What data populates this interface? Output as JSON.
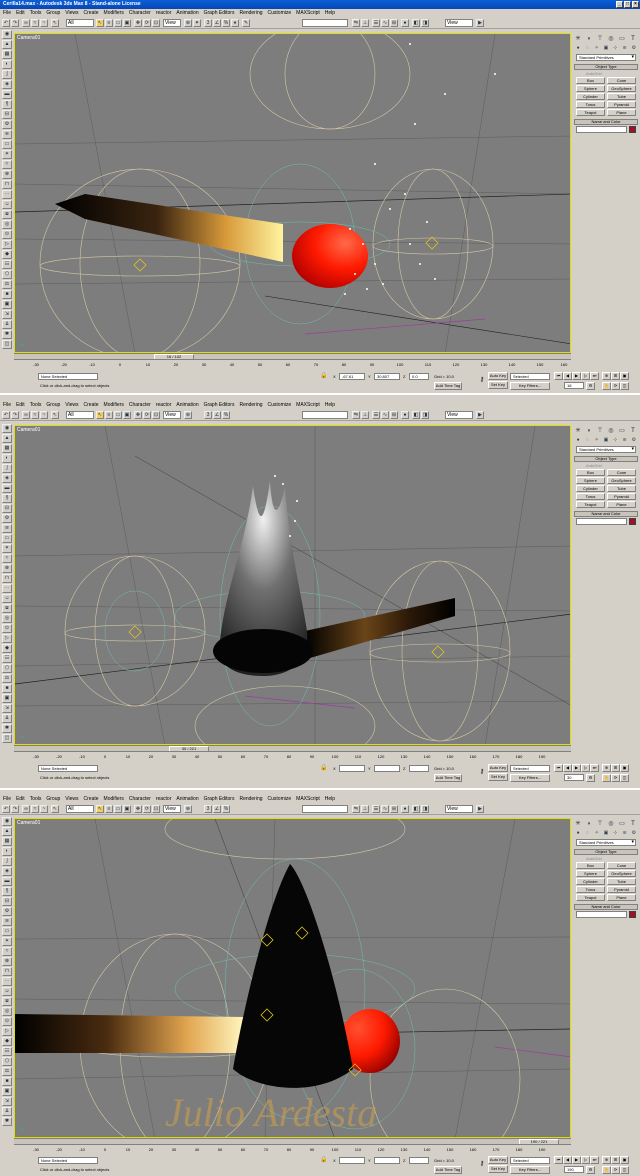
{
  "app": {
    "title": "Cerilla14.max - Autodesk 3ds Max 8 - Stand-alone License",
    "win_buttons": [
      "_",
      "□",
      "×"
    ]
  },
  "menu": [
    "File",
    "Edit",
    "Tools",
    "Group",
    "Views",
    "Create",
    "Modifiers",
    "Character",
    "reactor",
    "Animation",
    "Graph Editors",
    "Rendering",
    "Customize",
    "MAXScript",
    "Help"
  ],
  "toolbar": {
    "selection_filter": "All",
    "ref_coord": "View",
    "named_selection": "",
    "view_dropdown": "View"
  },
  "viewport": {
    "label": "Camera01"
  },
  "command_panel": {
    "category": "Standard Primitives",
    "object_type_header": "Object Type",
    "autogrid": "AutoGrid",
    "primitives": [
      "Box",
      "Cone",
      "Sphere",
      "GeoSphere",
      "Cylinder",
      "Tube",
      "Torus",
      "Pyramid",
      "Teapot",
      "Plane"
    ],
    "name_color_header": "Name and Color",
    "swatch_color": "#a0102a"
  },
  "colors": {
    "viewport_bg": "#7d7d7d",
    "active_border": "#e0e000",
    "match_red": "#ff2a00",
    "wood": "#d4a24a"
  },
  "ruler_ticks": [
    "-30",
    "-20",
    "-10",
    "0",
    "10",
    "20",
    "30",
    "40",
    "50",
    "60",
    "70",
    "80",
    "90",
    "100",
    "110",
    "120",
    "130",
    "140",
    "150",
    "160"
  ],
  "ruler_ticks_b": [
    "-30",
    "-20",
    "-10",
    "0",
    "10",
    "20",
    "30",
    "40",
    "50",
    "60",
    "70",
    "80",
    "90",
    "100",
    "110",
    "120",
    "130",
    "140",
    "150",
    "160",
    "170",
    "180",
    "190"
  ],
  "status": {
    "selection": "None Selected",
    "prompt": "Click or click-and-drag to select objects",
    "x_label": "X",
    "y_label": "Y",
    "z_label": "Z",
    "grid": "Grid = 10.0",
    "auto_key": "Auto Key",
    "set_key": "Set Key",
    "key_mode": "Selected",
    "key_filters": "Key Filters...",
    "add_time_tag": "Add Time Tag"
  },
  "panels": [
    {
      "frame_label": "16 / 102",
      "frame": "16",
      "x": "-67.61",
      "y": "30.807",
      "z": "0.0"
    },
    {
      "frame_label": "30 / 221",
      "frame": "30",
      "x": "",
      "y": "",
      "z": ""
    },
    {
      "frame_label": "190 / 221",
      "frame": "190",
      "x": "",
      "y": "",
      "z": ""
    }
  ],
  "watermark": "Julio Ardesta"
}
